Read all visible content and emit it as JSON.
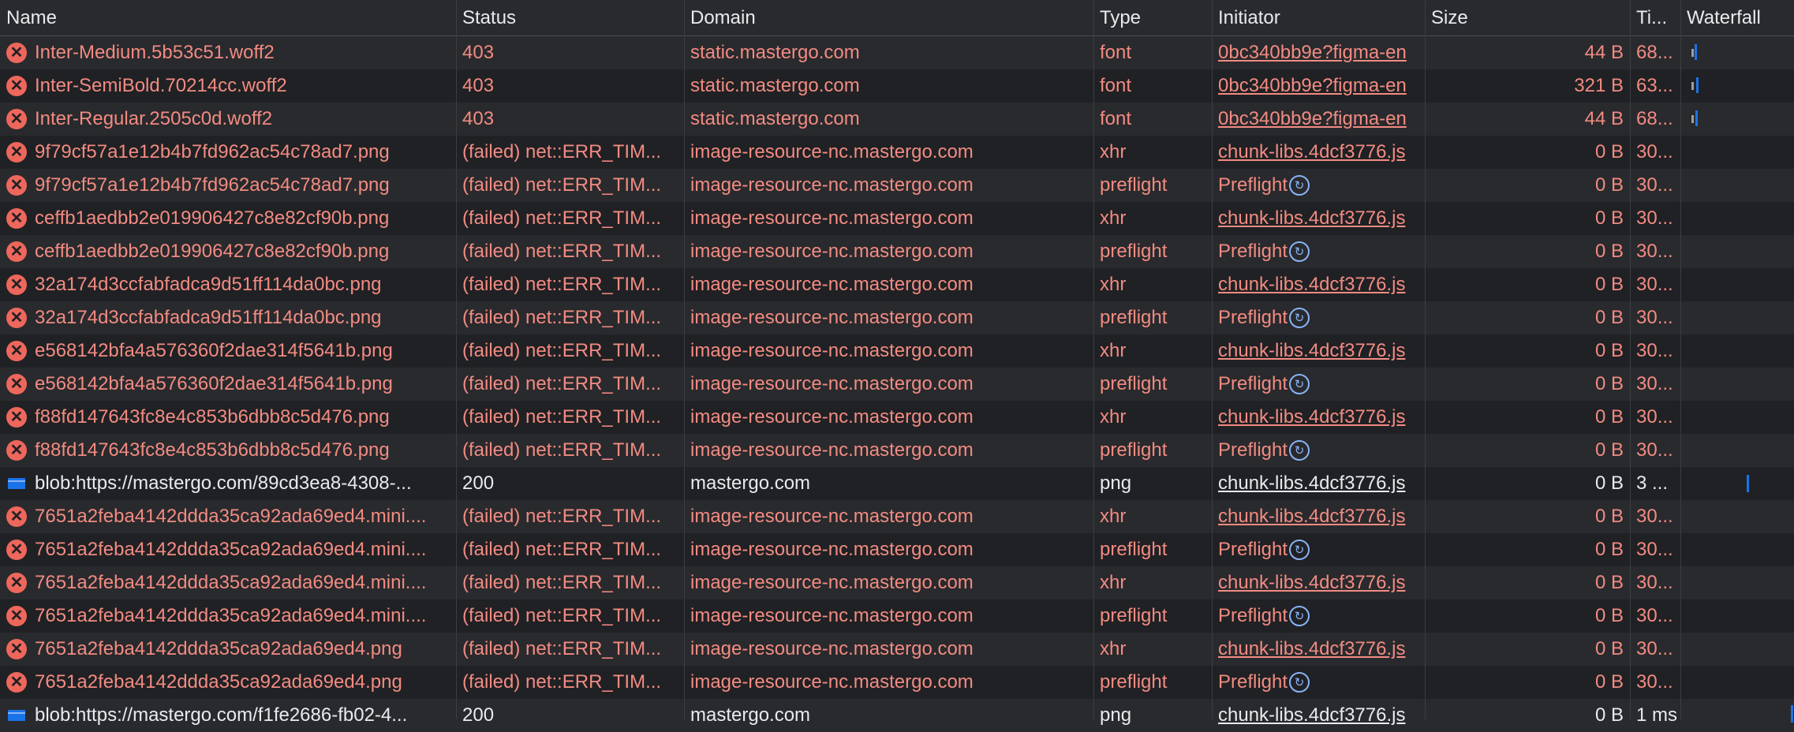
{
  "columns": {
    "name": "Name",
    "status": "Status",
    "domain": "Domain",
    "type": "Type",
    "initiator": "Initiator",
    "size": "Size",
    "time": "Ti...",
    "waterfall": "Waterfall"
  },
  "rows": [
    {
      "name": "Inter-Medium.5b53c51.woff2",
      "status": "403",
      "domain": "static.mastergo.com",
      "type": "font",
      "initiator": "0bc340bb9e?figma-en",
      "size": "44 B",
      "time": "68...",
      "icon": "error-icon",
      "error": true,
      "preflight": false
    },
    {
      "name": "Inter-SemiBold.70214cc.woff2",
      "status": "403",
      "domain": "static.mastergo.com",
      "type": "font",
      "initiator": "0bc340bb9e?figma-en",
      "size": "321 B",
      "time": "63...",
      "icon": "error-icon",
      "error": true,
      "preflight": false
    },
    {
      "name": "Inter-Regular.2505c0d.woff2",
      "status": "403",
      "domain": "static.mastergo.com",
      "type": "font",
      "initiator": "0bc340bb9e?figma-en",
      "size": "44 B",
      "time": "68...",
      "icon": "error-icon",
      "error": true,
      "preflight": false
    },
    {
      "name": "9f79cf57a1e12b4b7fd962ac54c78ad7.png",
      "status": "(failed) net::ERR_TIM...",
      "domain": "image-resource-nc.mastergo.com",
      "type": "xhr",
      "initiator": "chunk-libs.4dcf3776.js",
      "size": "0 B",
      "time": "30...",
      "icon": "error-icon",
      "error": true,
      "preflight": false
    },
    {
      "name": "9f79cf57a1e12b4b7fd962ac54c78ad7.png",
      "status": "(failed) net::ERR_TIM...",
      "domain": "image-resource-nc.mastergo.com",
      "type": "preflight",
      "initiator": "Preflight",
      "size": "0 B",
      "time": "30...",
      "icon": "error-icon",
      "error": true,
      "preflight": true
    },
    {
      "name": "ceffb1aedbb2e019906427c8e82cf90b.png",
      "status": "(failed) net::ERR_TIM...",
      "domain": "image-resource-nc.mastergo.com",
      "type": "xhr",
      "initiator": "chunk-libs.4dcf3776.js",
      "size": "0 B",
      "time": "30...",
      "icon": "error-icon",
      "error": true,
      "preflight": false
    },
    {
      "name": "ceffb1aedbb2e019906427c8e82cf90b.png",
      "status": "(failed) net::ERR_TIM...",
      "domain": "image-resource-nc.mastergo.com",
      "type": "preflight",
      "initiator": "Preflight",
      "size": "0 B",
      "time": "30...",
      "icon": "error-icon",
      "error": true,
      "preflight": true
    },
    {
      "name": "32a174d3ccfabfadca9d51ff114da0bc.png",
      "status": "(failed) net::ERR_TIM...",
      "domain": "image-resource-nc.mastergo.com",
      "type": "xhr",
      "initiator": "chunk-libs.4dcf3776.js",
      "size": "0 B",
      "time": "30...",
      "icon": "error-icon",
      "error": true,
      "preflight": false
    },
    {
      "name": "32a174d3ccfabfadca9d51ff114da0bc.png",
      "status": "(failed) net::ERR_TIM...",
      "domain": "image-resource-nc.mastergo.com",
      "type": "preflight",
      "initiator": "Preflight",
      "size": "0 B",
      "time": "30...",
      "icon": "error-icon",
      "error": true,
      "preflight": true
    },
    {
      "name": "e568142bfa4a576360f2dae314f5641b.png",
      "status": "(failed) net::ERR_TIM...",
      "domain": "image-resource-nc.mastergo.com",
      "type": "xhr",
      "initiator": "chunk-libs.4dcf3776.js",
      "size": "0 B",
      "time": "30...",
      "icon": "error-icon",
      "error": true,
      "preflight": false
    },
    {
      "name": "e568142bfa4a576360f2dae314f5641b.png",
      "status": "(failed) net::ERR_TIM...",
      "domain": "image-resource-nc.mastergo.com",
      "type": "preflight",
      "initiator": "Preflight",
      "size": "0 B",
      "time": "30...",
      "icon": "error-icon",
      "error": true,
      "preflight": true
    },
    {
      "name": "f88fd147643fc8e4c853b6dbb8c5d476.png",
      "status": "(failed) net::ERR_TIM...",
      "domain": "image-resource-nc.mastergo.com",
      "type": "xhr",
      "initiator": "chunk-libs.4dcf3776.js",
      "size": "0 B",
      "time": "30...",
      "icon": "error-icon",
      "error": true,
      "preflight": false
    },
    {
      "name": "f88fd147643fc8e4c853b6dbb8c5d476.png",
      "status": "(failed) net::ERR_TIM...",
      "domain": "image-resource-nc.mastergo.com",
      "type": "preflight",
      "initiator": "Preflight",
      "size": "0 B",
      "time": "30...",
      "icon": "error-icon",
      "error": true,
      "preflight": true
    },
    {
      "name": "blob:https://mastergo.com/89cd3ea8-4308-...",
      "status": "200",
      "domain": "mastergo.com",
      "type": "png",
      "initiator": "chunk-libs.4dcf3776.js",
      "size": "0 B",
      "time": "3 ...",
      "icon": "image-file-icon",
      "error": false,
      "preflight": false
    },
    {
      "name": "7651a2feba4142ddda35ca92ada69ed4.mini....",
      "status": "(failed) net::ERR_TIM...",
      "domain": "image-resource-nc.mastergo.com",
      "type": "xhr",
      "initiator": "chunk-libs.4dcf3776.js",
      "size": "0 B",
      "time": "30...",
      "icon": "error-icon",
      "error": true,
      "preflight": false
    },
    {
      "name": "7651a2feba4142ddda35ca92ada69ed4.mini....",
      "status": "(failed) net::ERR_TIM...",
      "domain": "image-resource-nc.mastergo.com",
      "type": "preflight",
      "initiator": "Preflight",
      "size": "0 B",
      "time": "30...",
      "icon": "error-icon",
      "error": true,
      "preflight": true
    },
    {
      "name": "7651a2feba4142ddda35ca92ada69ed4.mini....",
      "status": "(failed) net::ERR_TIM...",
      "domain": "image-resource-nc.mastergo.com",
      "type": "xhr",
      "initiator": "chunk-libs.4dcf3776.js",
      "size": "0 B",
      "time": "30...",
      "icon": "error-icon",
      "error": true,
      "preflight": false
    },
    {
      "name": "7651a2feba4142ddda35ca92ada69ed4.mini....",
      "status": "(failed) net::ERR_TIM...",
      "domain": "image-resource-nc.mastergo.com",
      "type": "preflight",
      "initiator": "Preflight",
      "size": "0 B",
      "time": "30...",
      "icon": "error-icon",
      "error": true,
      "preflight": true
    },
    {
      "name": "7651a2feba4142ddda35ca92ada69ed4.png",
      "status": "(failed) net::ERR_TIM...",
      "domain": "image-resource-nc.mastergo.com",
      "type": "xhr",
      "initiator": "chunk-libs.4dcf3776.js",
      "size": "0 B",
      "time": "30...",
      "icon": "error-icon",
      "error": true,
      "preflight": false
    },
    {
      "name": "7651a2feba4142ddda35ca92ada69ed4.png",
      "status": "(failed) net::ERR_TIM...",
      "domain": "image-resource-nc.mastergo.com",
      "type": "preflight",
      "initiator": "Preflight",
      "size": "0 B",
      "time": "30...",
      "icon": "error-icon",
      "error": true,
      "preflight": true
    },
    {
      "name": "blob:https://mastergo.com/f1fe2686-fb02-4...",
      "status": "200",
      "domain": "mastergo.com",
      "type": "png",
      "initiator": "chunk-libs.4dcf3776.js",
      "size": "0 B",
      "time": "1 ms",
      "icon": "image-file-icon",
      "error": false,
      "preflight": false
    }
  ],
  "colors": {
    "error_text": "#f28b82",
    "row_even": "#202124",
    "row_odd": "#292a2d",
    "waterfall_bar": "#1a73e8"
  }
}
